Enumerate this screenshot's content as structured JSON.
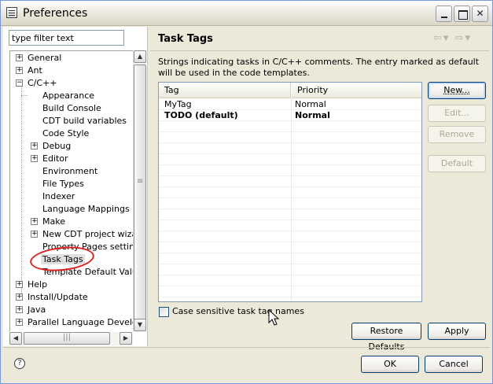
{
  "window": {
    "title": "Preferences"
  },
  "filter": {
    "placeholder": "type filter text",
    "value": "type filter text"
  },
  "tree": {
    "general": "General",
    "ant": "Ant",
    "cpp": "C/C++",
    "cpp_children": [
      "Appearance",
      "Build Console",
      "CDT build variables",
      "Code Style",
      "Debug",
      "Editor",
      "Environment",
      "File Types",
      "Indexer",
      "Language Mappings",
      "Make",
      "New CDT project wizard",
      "Property Pages settings",
      "Task Tags",
      "Template Default Values"
    ],
    "help": "Help",
    "install_update": "Install/Update",
    "java": "Java",
    "parallel": "Parallel Language Developm"
  },
  "page": {
    "title": "Task Tags",
    "description": "Strings indicating tasks in C/C++ comments. The entry marked as default will be used in the code templates."
  },
  "table": {
    "headers": [
      "Tag",
      "Priority"
    ],
    "rows": [
      {
        "tag": "MyTag",
        "priority": "Normal"
      },
      {
        "tag": "TODO (default)",
        "priority": "Normal"
      }
    ]
  },
  "buttons": {
    "new": "New...",
    "edit": "Edit...",
    "remove": "Remove",
    "default": "Default",
    "restore_defaults": "Restore Defaults",
    "apply": "Apply",
    "ok": "OK",
    "cancel": "Cancel"
  },
  "checkbox": {
    "label": "Case sensitive task tag names",
    "checked": false
  },
  "help": {
    "glyph": "?"
  },
  "colors": {
    "annotation": "#e02020",
    "selection": "#e0e0e0"
  }
}
